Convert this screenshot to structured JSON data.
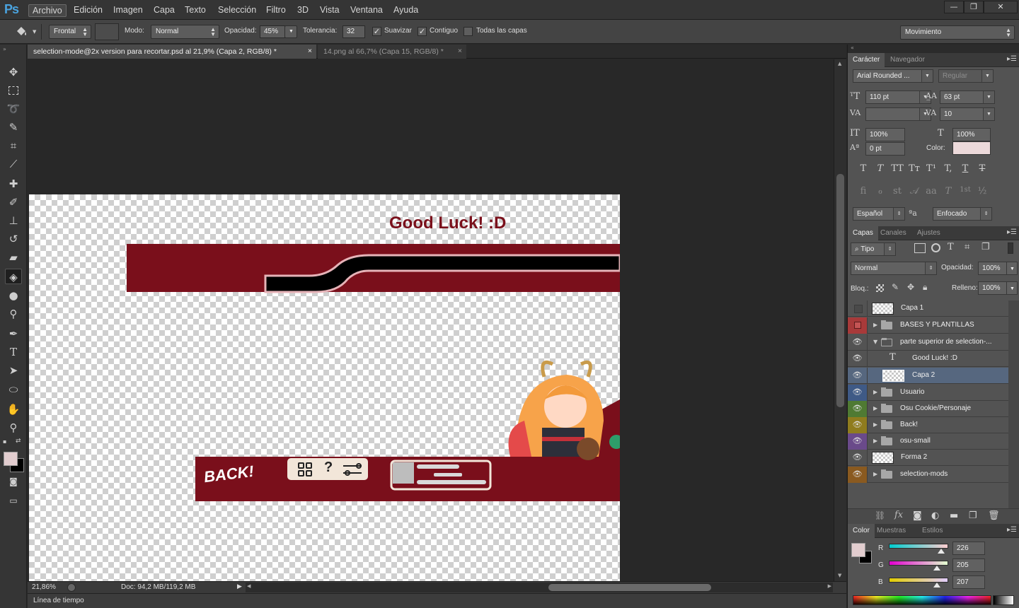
{
  "app": {
    "logo": "Ps"
  },
  "menu": [
    "Archivo",
    "Edición",
    "Imagen",
    "Capa",
    "Texto",
    "Selección",
    "Filtro",
    "3D",
    "Vista",
    "Ventana",
    "Ayuda"
  ],
  "window_controls": {
    "minimize": "—",
    "restore": "❐",
    "close": "✕"
  },
  "options": {
    "fill_source": "Frontal",
    "mode_label": "Modo:",
    "mode_value": "Normal",
    "opacity_label": "Opacidad:",
    "opacity_value": "45%",
    "tolerance_label": "Tolerancia:",
    "tolerance_value": "32",
    "antialias_label": "Suavizar",
    "antialias_checked": true,
    "contiguous_label": "Contiguo",
    "contiguous_checked": true,
    "all_layers_label": "Todas las capas",
    "all_layers_checked": false,
    "workspace": "Movimiento"
  },
  "tabs": [
    {
      "label": "selection-mode@2x version para recortar.psd  al 21,9% (Capa 2, RGB/8) *",
      "close": "×",
      "active": true
    },
    {
      "label": "14.png al 66,7% (Capa 15, RGB/8) *",
      "close": "×",
      "active": false
    }
  ],
  "tools": [
    "move-icon",
    "marquee-icon",
    "lasso-icon",
    "quick-select-icon",
    "crop-icon",
    "eyedropper-icon",
    "healing-brush-icon",
    "brush-icon",
    "clone-stamp-icon",
    "history-brush-icon",
    "eraser-icon",
    "paint-bucket-icon",
    "blur-icon",
    "dodge-icon",
    "pen-icon",
    "type-icon",
    "path-select-icon",
    "ellipse-icon",
    "hand-icon",
    "zoom-icon"
  ],
  "canvas": {
    "good_luck_text": "Good Luck!        :D",
    "back_text": "BACK!",
    "question_mark": "?",
    "colors": {
      "banner": "#7a0f1b",
      "bar": "#000000",
      "stroke": "#e6b3b8",
      "button_bg": "#f2e6d9"
    }
  },
  "status": {
    "zoom": "21,86%",
    "doc": "Doc: 94,2 MB/119,2 MB"
  },
  "timeline": {
    "label": "Línea de tiempo"
  },
  "character_panel": {
    "tabs": [
      "Carácter",
      "Navegador"
    ],
    "font_family": "Arial Rounded ...",
    "font_style": "Regular",
    "font_size": "110 pt",
    "leading": "63 pt",
    "kerning": "",
    "tracking": "10",
    "vertical_scale": "100%",
    "horizontal_scale": "100%",
    "baseline_shift": "0 pt",
    "color_label": "Color:",
    "color_value": "#ecd9da",
    "style_buttons": [
      "T",
      "T",
      "TT",
      "Tт",
      "T¹",
      "T,",
      "T",
      "T"
    ],
    "opentype_buttons": [
      "ﬁ",
      "ℴ",
      "st",
      "𝒜",
      "aa",
      "T",
      "1st",
      "½"
    ],
    "language": "Español",
    "aa_icon": "ªa",
    "antialias_method": "Enfocado"
  },
  "layers_panel": {
    "tabs": [
      "Capas",
      "Canales",
      "Ajustes"
    ],
    "filter_kind": "Tipo",
    "blend_mode": "Normal",
    "opacity_label": "Opacidad:",
    "opacity_value": "100%",
    "lock_label": "Bloq.:",
    "fill_label": "Relleno:",
    "fill_value": "100%",
    "layers": [
      {
        "name": "Capa 1",
        "type": "pixel",
        "visible": false,
        "color": ""
      },
      {
        "name": "BASES Y PLANTILLAS",
        "type": "group",
        "visible": false,
        "color": "#a83a3a"
      },
      {
        "name": "parte superior de selection-...",
        "type": "group-open",
        "visible": true,
        "color": ""
      },
      {
        "name": "Good Luck!         :D",
        "type": "text",
        "visible": true,
        "color": ""
      },
      {
        "name": "Capa 2",
        "type": "pixel",
        "visible": true,
        "color": "",
        "selected": true
      },
      {
        "name": "Usuario",
        "type": "group",
        "visible": true,
        "color": "#3f5a86"
      },
      {
        "name": "Osu Cookie/Personaje",
        "type": "group",
        "visible": true,
        "color": "#4f7a33"
      },
      {
        "name": "Back!",
        "type": "group",
        "visible": true,
        "color": "#8f7c1e"
      },
      {
        "name": "osu-small",
        "type": "group",
        "visible": true,
        "color": "#6a4a8a"
      },
      {
        "name": "Forma 2",
        "type": "pixel",
        "visible": true,
        "color": ""
      },
      {
        "name": "selection-mods",
        "type": "group",
        "visible": true,
        "color": "#8a5a20"
      }
    ]
  },
  "color_panel": {
    "tabs": [
      "Color",
      "Muestras",
      "Estilos"
    ],
    "r_label": "R",
    "r_value": "226",
    "g_label": "G",
    "g_value": "205",
    "b_label": "B",
    "b_value": "207",
    "r_level": 0.886,
    "g_level": 0.804,
    "b_level": 0.812,
    "foreground": "#e2cdcf",
    "background": "#000000"
  }
}
